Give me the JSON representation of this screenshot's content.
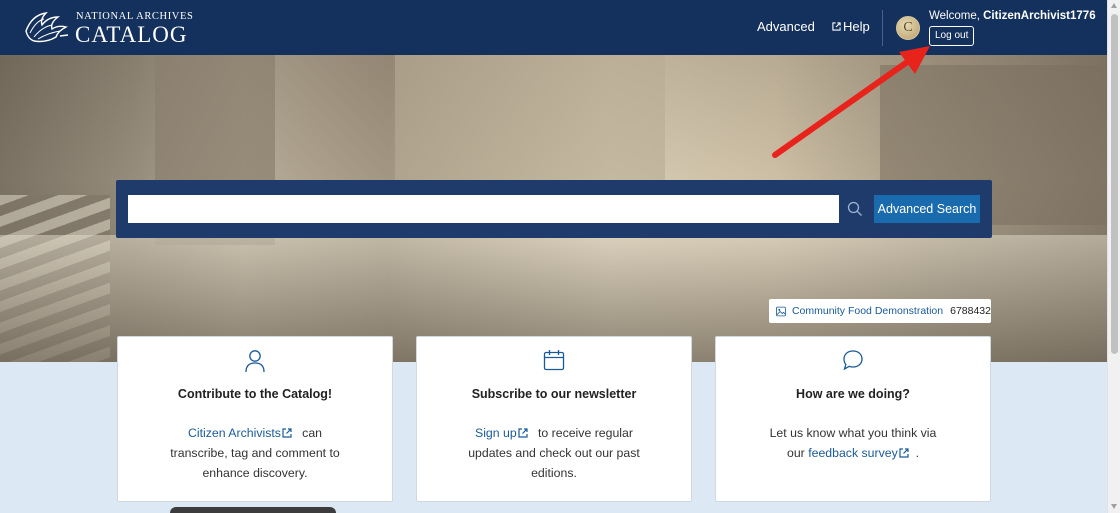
{
  "header": {
    "logo_small": "NATIONAL ARCHIVES",
    "logo_big": "CATALOG",
    "nav_advanced": "Advanced",
    "nav_help": "Help",
    "avatar_letter": "C",
    "welcome_prefix": "Welcome, ",
    "username": "CitizenArchivist1776",
    "logout_label": "Log out"
  },
  "search": {
    "placeholder": "",
    "button_label": "Advanced Search"
  },
  "hero_credit": {
    "title": "Community Food Demonstration",
    "id": "6788432"
  },
  "cards": [
    {
      "title": "Contribute to the Catalog!",
      "link_text": "Citizen Archivists",
      "text_after": "can",
      "text_line2": "transcribe, tag and comment to",
      "text_line3": "enhance discovery."
    },
    {
      "title": "Subscribe to our newsletter",
      "link_text": "Sign up",
      "text_after": "to receive regular",
      "text_line2": "updates and check out our past",
      "text_line3": "editions."
    },
    {
      "title": "How are we doing?",
      "text_line1": "Let us know what you think via",
      "text_before": "our",
      "link_text": "feedback survey",
      "text_after": "."
    }
  ],
  "colors": {
    "header_bg": "#14305c",
    "search_band": "#1f3b6b",
    "button_blue": "#1a6bae",
    "link_blue": "#1a5a99",
    "lower_bg": "#dde8f5",
    "annotation_arrow": "#e8231b"
  }
}
